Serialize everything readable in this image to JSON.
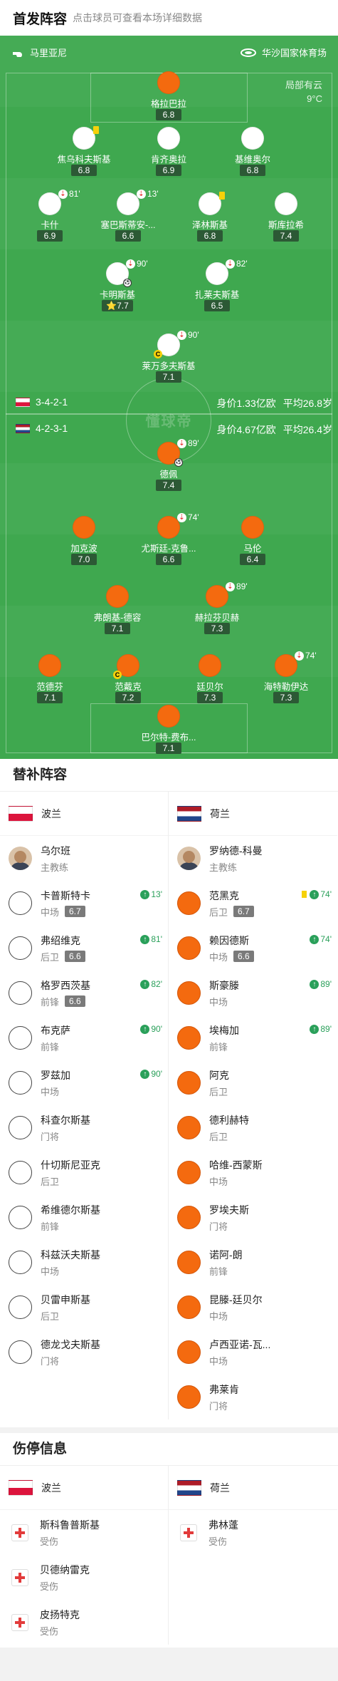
{
  "header": {
    "title": "首发阵容",
    "subtitle": "点击球员可查看本场详细数据"
  },
  "pitch": {
    "referee": "马里亚尼",
    "stadium": "华沙国家体育场",
    "weather": "局部有云",
    "temperature": "9°C",
    "watermark": "懂球帝",
    "home": {
      "formation": "3-4-2-1",
      "value": "身价1.33亿欧",
      "age": "平均26.8岁"
    },
    "away": {
      "formation": "4-2-3-1",
      "value": "身价4.67亿欧",
      "age": "平均26.4岁"
    },
    "players": [
      {
        "name": "格拉巴拉",
        "rating": "6.8",
        "color": "o"
      },
      {
        "name": "焦乌科夫斯基",
        "rating": "6.8",
        "color": "w"
      },
      {
        "name": "肯齐奥拉",
        "rating": "6.9",
        "color": "w"
      },
      {
        "name": "基维奥尔",
        "rating": "6.8",
        "color": "w"
      },
      {
        "name": "卡什",
        "rating": "6.9",
        "color": "w",
        "sub": "81'"
      },
      {
        "name": "塞巴斯蒂安-...",
        "rating": "6.6",
        "color": "w",
        "sub": "13'"
      },
      {
        "name": "泽林斯基",
        "rating": "6.8",
        "color": "w"
      },
      {
        "name": "斯库拉希",
        "rating": "7.4",
        "color": "w"
      },
      {
        "name": "卡明斯基",
        "rating": "7.7",
        "color": "w",
        "sub": "90'"
      },
      {
        "name": "扎莱夫斯基",
        "rating": "6.5",
        "color": "w",
        "sub": "82'"
      },
      {
        "name": "莱万多夫斯基",
        "rating": "7.1",
        "color": "w",
        "sub": "90'"
      },
      {
        "name": "德佩",
        "rating": "7.4",
        "color": "o",
        "sub": "89'"
      },
      {
        "name": "加克波",
        "rating": "7.0",
        "color": "o"
      },
      {
        "name": "尤斯廷-克鲁...",
        "rating": "6.6",
        "color": "o",
        "sub": "74'"
      },
      {
        "name": "马伦",
        "rating": "6.4",
        "color": "o"
      },
      {
        "name": "弗朗基-德容",
        "rating": "7.1",
        "color": "o"
      },
      {
        "name": "赫拉芬贝赫",
        "rating": "7.3",
        "color": "o",
        "sub": "89'"
      },
      {
        "name": "范德芬",
        "rating": "7.1",
        "color": "o"
      },
      {
        "name": "范戴克",
        "rating": "7.2",
        "color": "o"
      },
      {
        "name": "廷贝尔",
        "rating": "7.3",
        "color": "o"
      },
      {
        "name": "海特勒伊达",
        "rating": "7.3",
        "color": "o",
        "sub": "74'"
      },
      {
        "name": "巴尔特-费布...",
        "rating": "7.1",
        "color": "o"
      }
    ]
  },
  "subs": {
    "title": "替补阵容",
    "home_team": "波兰",
    "away_team": "荷兰",
    "home": [
      {
        "name": "乌尔班",
        "pos": "主教练"
      },
      {
        "name": "卡普斯特卡",
        "pos": "中场",
        "rating": "6.7",
        "min": "13'"
      },
      {
        "name": "弗绍维克",
        "pos": "后卫",
        "rating": "6.6",
        "min": "81'"
      },
      {
        "name": "格罗西茨基",
        "pos": "前锋",
        "rating": "6.6",
        "min": "82'"
      },
      {
        "name": "布克萨",
        "pos": "前锋",
        "min": "90'"
      },
      {
        "name": "罗兹加",
        "pos": "中场",
        "min": "90'"
      },
      {
        "name": "科查尔斯基",
        "pos": "门将"
      },
      {
        "name": "什切斯尼亚克",
        "pos": "后卫"
      },
      {
        "name": "希维德尔斯基",
        "pos": "前锋"
      },
      {
        "name": "科兹沃夫斯基",
        "pos": "中场"
      },
      {
        "name": "贝雷申斯基",
        "pos": "后卫"
      },
      {
        "name": "德龙戈夫斯基",
        "pos": "门将"
      }
    ],
    "away": [
      {
        "name": "罗纳德-科曼",
        "pos": "主教练"
      },
      {
        "name": "范黑克",
        "pos": "后卫",
        "rating": "6.7",
        "min": "74'"
      },
      {
        "name": "赖因德斯",
        "pos": "中场",
        "rating": "6.6",
        "min": "74'"
      },
      {
        "name": "斯豪滕",
        "pos": "中场",
        "min": "89'"
      },
      {
        "name": "埃梅加",
        "pos": "前锋",
        "min": "89'"
      },
      {
        "name": "阿克",
        "pos": "后卫"
      },
      {
        "name": "德利赫特",
        "pos": "后卫"
      },
      {
        "name": "哈维-西蒙斯",
        "pos": "中场"
      },
      {
        "name": "罗埃夫斯",
        "pos": "门将"
      },
      {
        "name": "诺阿-朗",
        "pos": "前锋"
      },
      {
        "name": "昆滕-廷贝尔",
        "pos": "中场"
      },
      {
        "name": "卢西亚诺-瓦...",
        "pos": "中场"
      },
      {
        "name": "弗莱肯",
        "pos": "门将"
      }
    ]
  },
  "injuries": {
    "title": "伤停信息",
    "home_team": "波兰",
    "away_team": "荷兰",
    "home": [
      {
        "name": "斯科鲁普斯基",
        "status": "受伤"
      },
      {
        "name": "贝德纳雷克",
        "status": "受伤"
      },
      {
        "name": "皮扬特克",
        "status": "受伤"
      }
    ],
    "away": [
      {
        "name": "弗林蓬",
        "status": "受伤"
      }
    ]
  },
  "colors": {
    "pitch": "#3fa84f",
    "away_kit": "#f46a0f",
    "home_kit": "#ffffff",
    "sub_in": "#2aa05a"
  }
}
